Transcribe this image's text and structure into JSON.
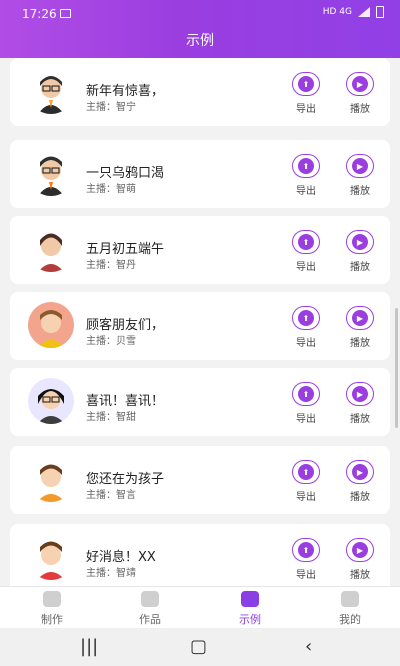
{
  "status": {
    "time": "17:26",
    "right": "HD 4G"
  },
  "header": {
    "title": "示例"
  },
  "items": [
    {
      "title": "新年有惊喜，",
      "host": "主播：智宁",
      "export": "导出",
      "play": "播放"
    },
    {
      "title": "一只乌鸦口渴",
      "host": "主播：智萌",
      "export": "导出",
      "play": "播放"
    },
    {
      "title": "五月初五端午",
      "host": "主播：智丹",
      "export": "导出",
      "play": "播放"
    },
    {
      "title": "顾客朋友们，",
      "host": "主播：贝雪",
      "export": "导出",
      "play": "播放"
    },
    {
      "title": "喜讯！喜讯！",
      "host": "主播：智甜",
      "export": "导出",
      "play": "播放"
    },
    {
      "title": "您还在为孩子",
      "host": "主播：智言",
      "export": "导出",
      "play": "播放"
    },
    {
      "title": "好消息！XX",
      "host": "主播：智靖",
      "export": "导出",
      "play": "播放"
    }
  ],
  "tabs": [
    {
      "label": "制作",
      "icon": "eye-icon",
      "active": false
    },
    {
      "label": "作品",
      "icon": "works-icon",
      "active": false
    },
    {
      "label": "示例",
      "icon": "clipboard-icon",
      "active": true
    },
    {
      "label": "我的",
      "icon": "profile-icon",
      "active": false
    }
  ],
  "colors": {
    "accent": "#9a3ee0",
    "header_start": "#b14de6",
    "header_end": "#9140e6"
  }
}
